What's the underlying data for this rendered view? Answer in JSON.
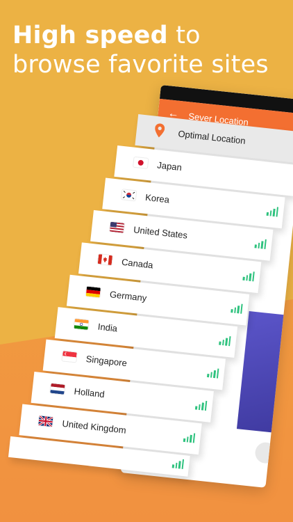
{
  "headline": {
    "bold": "High speed",
    "rest": " to browse favorite sites"
  },
  "phone": {
    "header_title": "Sever Location"
  },
  "list": {
    "optimal": "Optimal Location",
    "countries": [
      {
        "name": "Japan",
        "flag": "japan-flag-icon"
      },
      {
        "name": "Korea",
        "flag": "korea-flag-icon"
      },
      {
        "name": "United States",
        "flag": "us-flag-icon"
      },
      {
        "name": "Canada",
        "flag": "canada-flag-icon"
      },
      {
        "name": "Germany",
        "flag": "germany-flag-icon"
      },
      {
        "name": "India",
        "flag": "india-flag-icon"
      },
      {
        "name": "Singapore",
        "flag": "singapore-flag-icon"
      },
      {
        "name": "Holland",
        "flag": "netherlands-flag-icon"
      },
      {
        "name": "United Kingdom",
        "flag": "uk-flag-icon"
      }
    ]
  },
  "colors": {
    "accent": "#f36f31",
    "signal": "#2ec27e",
    "background": "#ecb244"
  }
}
